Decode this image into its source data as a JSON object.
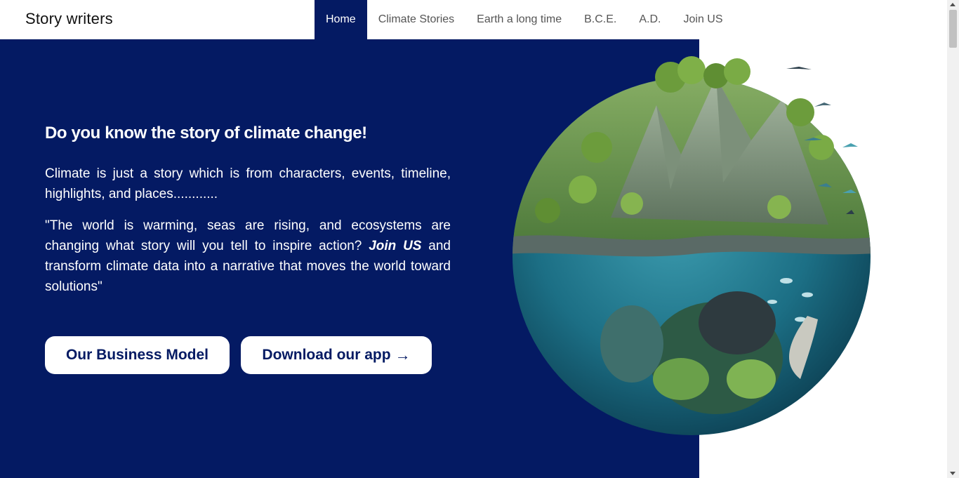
{
  "brand": "Story writers",
  "nav": {
    "items": [
      "Home",
      "Climate Stories",
      "Earth a long time",
      "B.C.E.",
      "A.D.",
      "Join US"
    ],
    "active": "Home"
  },
  "hero": {
    "headline": "Do you know the story of climate change!",
    "paragraph1": "Climate is just a story which is from characters, events, timeline, highlights, and places............",
    "paragraph2_before": "\"The world is warming, seas are rising, and ecosystems are changing what story will you tell to inspire action? ",
    "paragraph2_emphasis": "Join US",
    "paragraph2_after": " and transform climate data into a narrative that moves the world toward solutions\"",
    "buttons": {
      "business_model": "Our Business Model",
      "download_app": "Download our app",
      "download_icon": "arrow-right-icon"
    }
  },
  "colors": {
    "hero_bg": "#041a63",
    "nav_active_bg": "#041a63",
    "button_text": "#041a63"
  },
  "image": {
    "subject": "globe-illustration"
  }
}
